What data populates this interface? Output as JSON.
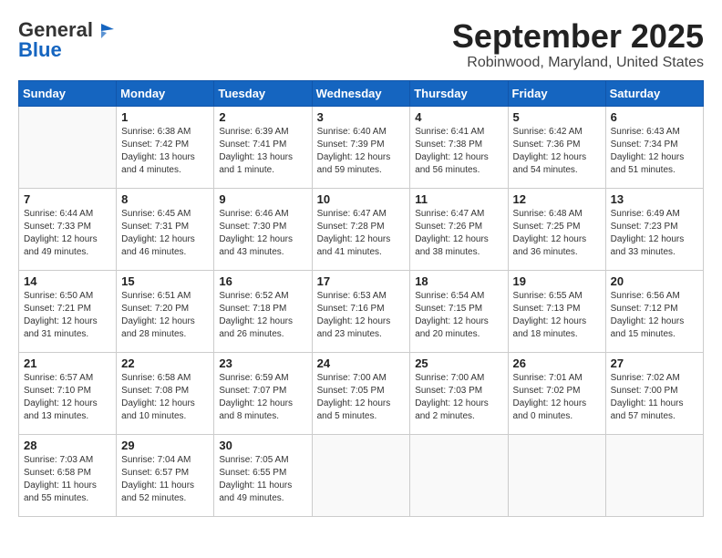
{
  "header": {
    "logo_general": "General",
    "logo_blue": "Blue",
    "title": "September 2025",
    "location": "Robinwood, Maryland, United States"
  },
  "days_of_week": [
    "Sunday",
    "Monday",
    "Tuesday",
    "Wednesday",
    "Thursday",
    "Friday",
    "Saturday"
  ],
  "weeks": [
    [
      {
        "day": "",
        "info": ""
      },
      {
        "day": "1",
        "info": "Sunrise: 6:38 AM\nSunset: 7:42 PM\nDaylight: 13 hours\nand 4 minutes."
      },
      {
        "day": "2",
        "info": "Sunrise: 6:39 AM\nSunset: 7:41 PM\nDaylight: 13 hours\nand 1 minute."
      },
      {
        "day": "3",
        "info": "Sunrise: 6:40 AM\nSunset: 7:39 PM\nDaylight: 12 hours\nand 59 minutes."
      },
      {
        "day": "4",
        "info": "Sunrise: 6:41 AM\nSunset: 7:38 PM\nDaylight: 12 hours\nand 56 minutes."
      },
      {
        "day": "5",
        "info": "Sunrise: 6:42 AM\nSunset: 7:36 PM\nDaylight: 12 hours\nand 54 minutes."
      },
      {
        "day": "6",
        "info": "Sunrise: 6:43 AM\nSunset: 7:34 PM\nDaylight: 12 hours\nand 51 minutes."
      }
    ],
    [
      {
        "day": "7",
        "info": "Sunrise: 6:44 AM\nSunset: 7:33 PM\nDaylight: 12 hours\nand 49 minutes."
      },
      {
        "day": "8",
        "info": "Sunrise: 6:45 AM\nSunset: 7:31 PM\nDaylight: 12 hours\nand 46 minutes."
      },
      {
        "day": "9",
        "info": "Sunrise: 6:46 AM\nSunset: 7:30 PM\nDaylight: 12 hours\nand 43 minutes."
      },
      {
        "day": "10",
        "info": "Sunrise: 6:47 AM\nSunset: 7:28 PM\nDaylight: 12 hours\nand 41 minutes."
      },
      {
        "day": "11",
        "info": "Sunrise: 6:47 AM\nSunset: 7:26 PM\nDaylight: 12 hours\nand 38 minutes."
      },
      {
        "day": "12",
        "info": "Sunrise: 6:48 AM\nSunset: 7:25 PM\nDaylight: 12 hours\nand 36 minutes."
      },
      {
        "day": "13",
        "info": "Sunrise: 6:49 AM\nSunset: 7:23 PM\nDaylight: 12 hours\nand 33 minutes."
      }
    ],
    [
      {
        "day": "14",
        "info": "Sunrise: 6:50 AM\nSunset: 7:21 PM\nDaylight: 12 hours\nand 31 minutes."
      },
      {
        "day": "15",
        "info": "Sunrise: 6:51 AM\nSunset: 7:20 PM\nDaylight: 12 hours\nand 28 minutes."
      },
      {
        "day": "16",
        "info": "Sunrise: 6:52 AM\nSunset: 7:18 PM\nDaylight: 12 hours\nand 26 minutes."
      },
      {
        "day": "17",
        "info": "Sunrise: 6:53 AM\nSunset: 7:16 PM\nDaylight: 12 hours\nand 23 minutes."
      },
      {
        "day": "18",
        "info": "Sunrise: 6:54 AM\nSunset: 7:15 PM\nDaylight: 12 hours\nand 20 minutes."
      },
      {
        "day": "19",
        "info": "Sunrise: 6:55 AM\nSunset: 7:13 PM\nDaylight: 12 hours\nand 18 minutes."
      },
      {
        "day": "20",
        "info": "Sunrise: 6:56 AM\nSunset: 7:12 PM\nDaylight: 12 hours\nand 15 minutes."
      }
    ],
    [
      {
        "day": "21",
        "info": "Sunrise: 6:57 AM\nSunset: 7:10 PM\nDaylight: 12 hours\nand 13 minutes."
      },
      {
        "day": "22",
        "info": "Sunrise: 6:58 AM\nSunset: 7:08 PM\nDaylight: 12 hours\nand 10 minutes."
      },
      {
        "day": "23",
        "info": "Sunrise: 6:59 AM\nSunset: 7:07 PM\nDaylight: 12 hours\nand 8 minutes."
      },
      {
        "day": "24",
        "info": "Sunrise: 7:00 AM\nSunset: 7:05 PM\nDaylight: 12 hours\nand 5 minutes."
      },
      {
        "day": "25",
        "info": "Sunrise: 7:00 AM\nSunset: 7:03 PM\nDaylight: 12 hours\nand 2 minutes."
      },
      {
        "day": "26",
        "info": "Sunrise: 7:01 AM\nSunset: 7:02 PM\nDaylight: 12 hours\nand 0 minutes."
      },
      {
        "day": "27",
        "info": "Sunrise: 7:02 AM\nSunset: 7:00 PM\nDaylight: 11 hours\nand 57 minutes."
      }
    ],
    [
      {
        "day": "28",
        "info": "Sunrise: 7:03 AM\nSunset: 6:58 PM\nDaylight: 11 hours\nand 55 minutes."
      },
      {
        "day": "29",
        "info": "Sunrise: 7:04 AM\nSunset: 6:57 PM\nDaylight: 11 hours\nand 52 minutes."
      },
      {
        "day": "30",
        "info": "Sunrise: 7:05 AM\nSunset: 6:55 PM\nDaylight: 11 hours\nand 49 minutes."
      },
      {
        "day": "",
        "info": ""
      },
      {
        "day": "",
        "info": ""
      },
      {
        "day": "",
        "info": ""
      },
      {
        "day": "",
        "info": ""
      }
    ]
  ]
}
